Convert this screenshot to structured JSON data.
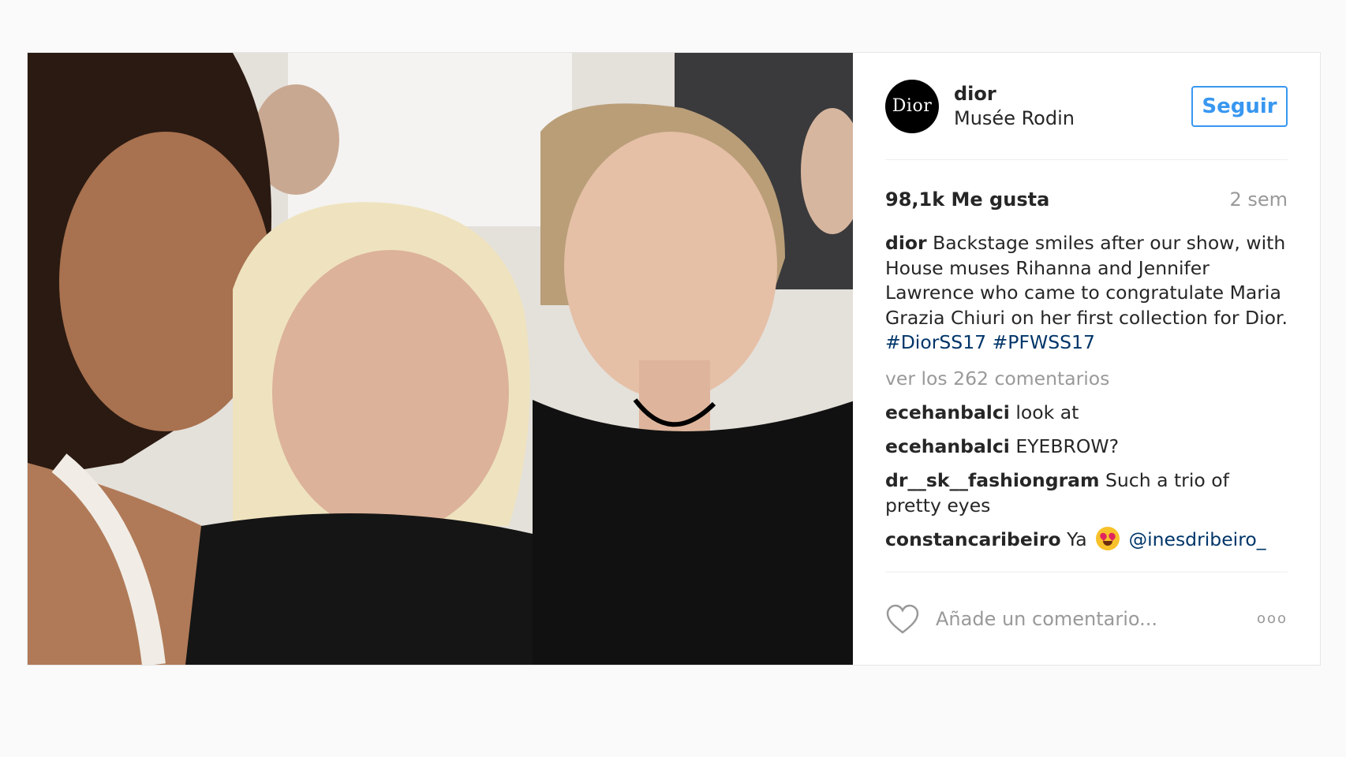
{
  "user": {
    "avatar_text": "Dior",
    "username": "dior",
    "location": "Musée Rodin",
    "follow_label": "Seguir"
  },
  "stats": {
    "likes": "98,1k Me gusta",
    "age": "2 sem"
  },
  "caption": {
    "user": "dior",
    "text": " Backstage smiles after our show, with House muses Rihanna and Jennifer Lawrence who came to congratulate Maria Grazia Chiuri on her first collection for Dior. ",
    "tag1": "#DiorSS17",
    "tag2": "#PFWSS17"
  },
  "view_all": "ver los 262 comentarios",
  "comments": [
    {
      "user": "ecehanbalci",
      "text": " look at"
    },
    {
      "user": "ecehanbalci",
      "text": " EYEBROW?"
    },
    {
      "user": "dr__sk__fashiongram",
      "text": " Such a trio of pretty eyes"
    },
    {
      "user": "constancaribeiro",
      "text": " Ya ",
      "mention": "@inesdribeiro_"
    }
  ],
  "footer": {
    "placeholder": "Añade un comentario...",
    "more": "ooo"
  },
  "colors": {
    "accent": "#3897f0",
    "hashtag": "#003569",
    "muted": "#999999"
  }
}
